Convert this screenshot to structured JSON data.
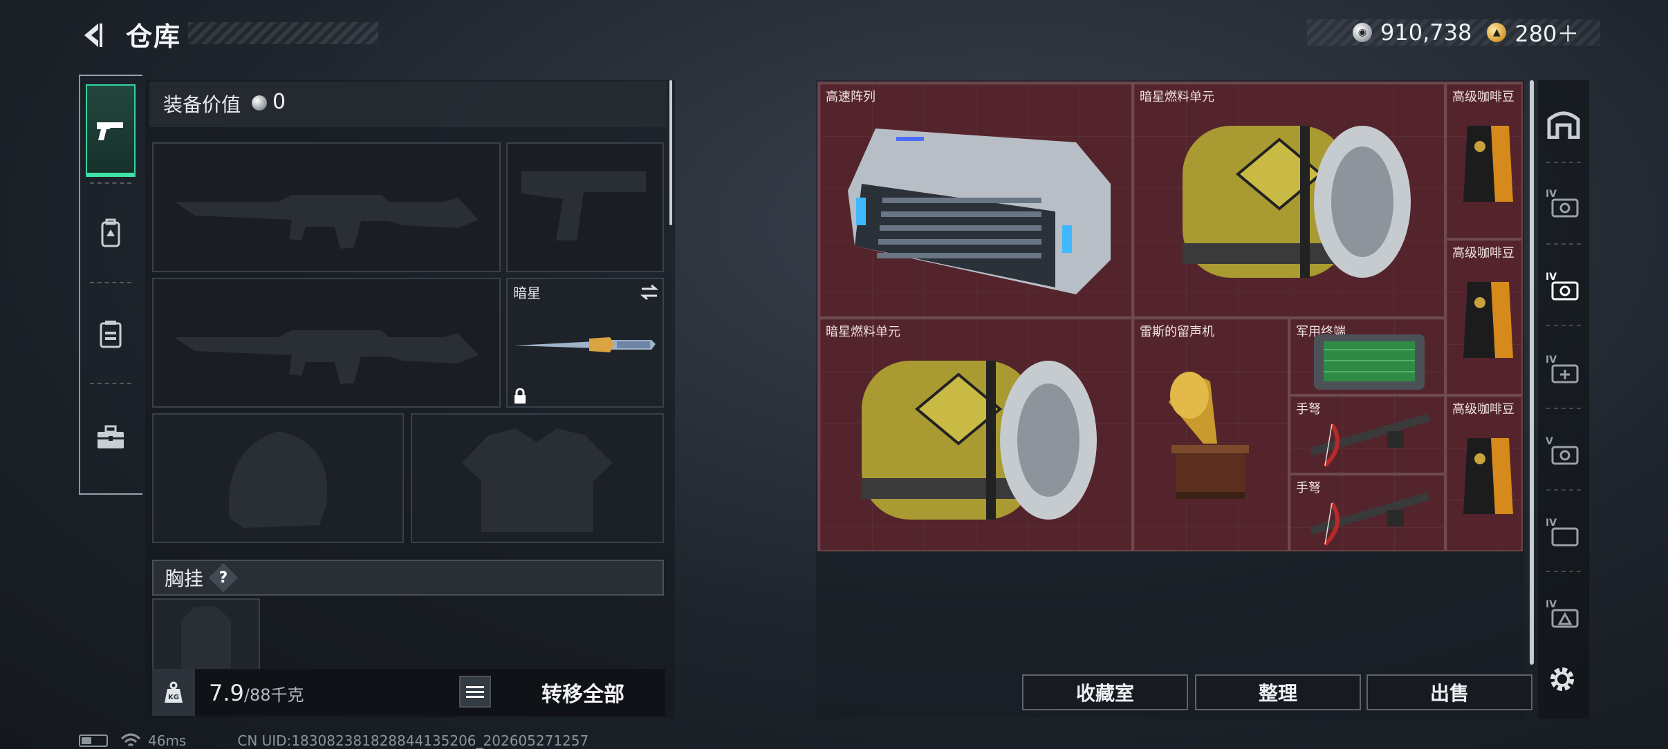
{
  "header": {
    "title": "仓库"
  },
  "currency": {
    "silver": "910,738",
    "gold": "280＋"
  },
  "nav": {
    "items": [
      "weapon",
      "backpack",
      "vest",
      "toolbox"
    ]
  },
  "equipment": {
    "value_label": "装备价值",
    "value": "0",
    "melee_slot": {
      "label": "暗星"
    },
    "chest_rig": {
      "label": "胸挂",
      "help": "?"
    }
  },
  "weight": {
    "current": "7.9",
    "capacity": "/88千克",
    "icon_text": "KG"
  },
  "actions": {
    "transfer_all": "转移全部"
  },
  "status": {
    "ping": "46ms",
    "uid": "CN UID:18308238182884413520​6_202605271257"
  },
  "stash": {
    "items": [
      {
        "label": "高速阵列"
      },
      {
        "label": "暗星燃料单元"
      },
      {
        "label": "高级咖啡豆"
      },
      {
        "label": "高级咖啡豆"
      },
      {
        "label": "暗星燃料单元"
      },
      {
        "label": "雷斯的留声机"
      },
      {
        "label": "军用终端"
      },
      {
        "label": "手弩"
      },
      {
        "label": "高级咖啡豆"
      },
      {
        "label": "手弩"
      }
    ]
  },
  "rail": {
    "tiers": [
      "IV",
      "IV",
      "IV",
      "V",
      "IV",
      "IV"
    ]
  },
  "bottom_buttons": {
    "collection": "收藏室",
    "sort": "整理",
    "sell": "出售"
  },
  "colors": {
    "accent": "#3fe3a6",
    "stash_bg": "#54242c"
  }
}
